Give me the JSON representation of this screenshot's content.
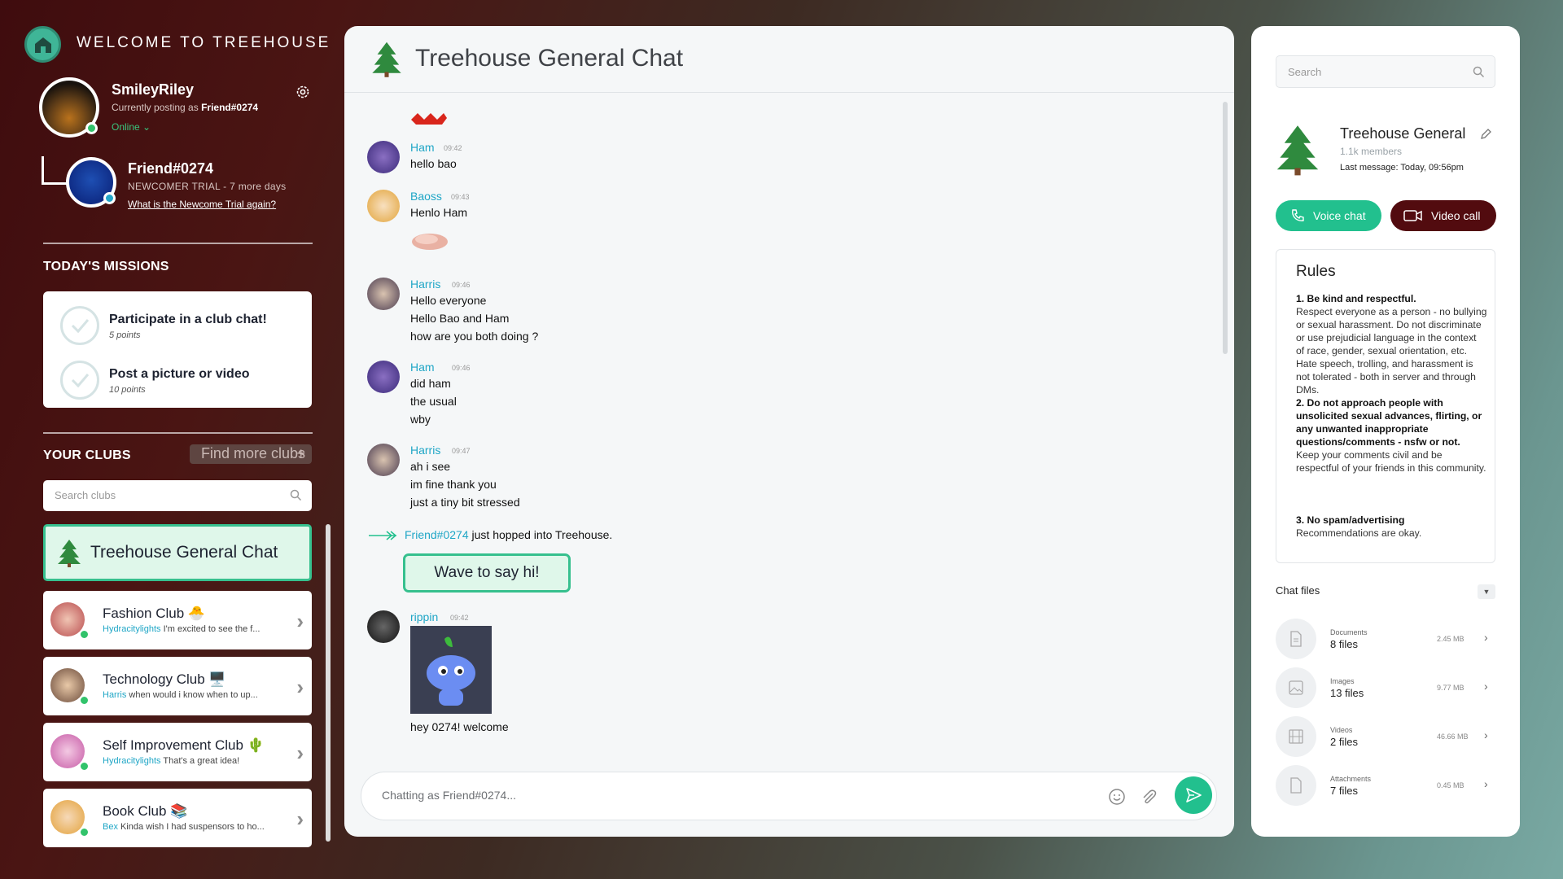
{
  "app": {
    "welcome": "WELCOME TO TREEHOUSE"
  },
  "profile": {
    "username": "SmileyRiley",
    "posting_prefix": "Currently posting as",
    "posting_as": "Friend#0274",
    "status": "Online ⌄"
  },
  "friend": {
    "name": "Friend#0274",
    "trial": "NEWCOMER TRIAL - 7 more days",
    "trial_link": "What is the Newcome Trial again?"
  },
  "missions": {
    "title": "TODAY'S MISSIONS",
    "items": [
      {
        "title": "Participate in a club chat!",
        "points": "5 points"
      },
      {
        "title": "Post a picture or video",
        "points": "10 points"
      }
    ]
  },
  "clubs": {
    "title": "YOUR CLUBS",
    "find_more": "Find more clubs",
    "search_placeholder": "Search clubs",
    "active": {
      "name": "Treehouse General Chat"
    },
    "items": [
      {
        "name": "Fashion Club 🐣",
        "author": "Hydracitylights",
        "preview": "I'm excited to see the f..."
      },
      {
        "name": "Technology Club 🖥️",
        "author": "Harris",
        "preview": "when would i know when to up..."
      },
      {
        "name": "Self Improvement Club 🌵",
        "author": "Hydracitylights",
        "preview": "That's a great idea!"
      },
      {
        "name": "Book Club 📚",
        "author": "Bex",
        "preview": "Kinda wish I had suspensors to ho..."
      }
    ]
  },
  "chat": {
    "title": "Treehouse General Chat",
    "messages": [
      {
        "author": "Ham",
        "time": "09:42",
        "lines": [
          "hello bao"
        ]
      },
      {
        "author": "Baoss",
        "time": "09:43",
        "lines": [
          "Henlo Ham"
        ]
      },
      {
        "author": "Harris",
        "time": "09:46",
        "lines": [
          "Hello everyone",
          "Hello Bao and Ham",
          "how are you both doing ?"
        ]
      },
      {
        "author": "Ham",
        "time": "09:46",
        "lines": [
          "did ham",
          "the usual",
          "wby"
        ]
      },
      {
        "author": "Harris",
        "time": "09:47",
        "lines": [
          "ah i see",
          "im fine thank you",
          "just a tiny bit stressed"
        ]
      },
      {
        "author": "rippin",
        "time": "09:42",
        "lines": [
          "hey 0274! welcome"
        ]
      }
    ],
    "join_user": "Friend#0274",
    "join_text": "just hopped into Treehouse.",
    "wave": "Wave to say hi!",
    "input_placeholder": "Chatting as Friend#0274..."
  },
  "panel": {
    "search_placeholder": "Search",
    "club_name": "Treehouse General",
    "members": "1.1k members",
    "last_label": "Last message:",
    "last_value": "Today, 09:56pm",
    "voice": "Voice chat",
    "video": "Video call",
    "rules_title": "Rules",
    "rules": [
      {
        "head": "1. Be kind and respectful.",
        "body": "Respect everyone as a person - no bullying or sexual harassment. Do not discriminate or use prejudicial language in the context of race, gender, sexual orientation, etc. Hate speech, trolling, and harassment is not tolerated - both in server and through DMs."
      },
      {
        "head": "2. Do not approach people with unsolicited sexual advances, flirting, or any unwanted inappropriate questions/comments - nsfw or not.",
        "body": "Keep your comments civil and be respectful of your friends in this community."
      },
      {
        "head": "3. No spam/advertising",
        "body": "Recommendations are okay."
      }
    ],
    "files_title": "Chat files",
    "files": [
      {
        "category": "Documents",
        "count": "8 files",
        "size": "2.45 MB"
      },
      {
        "category": "Images",
        "count": "13 files",
        "size": "9.77 MB"
      },
      {
        "category": "Videos",
        "count": "2 files",
        "size": "46.66 MB"
      },
      {
        "category": "Attachments",
        "count": "7 files",
        "size": "0.45 MB"
      }
    ]
  },
  "colors": {
    "accent": "#22c08e",
    "link": "#1fa6c6",
    "maroon": "#520b0f"
  }
}
